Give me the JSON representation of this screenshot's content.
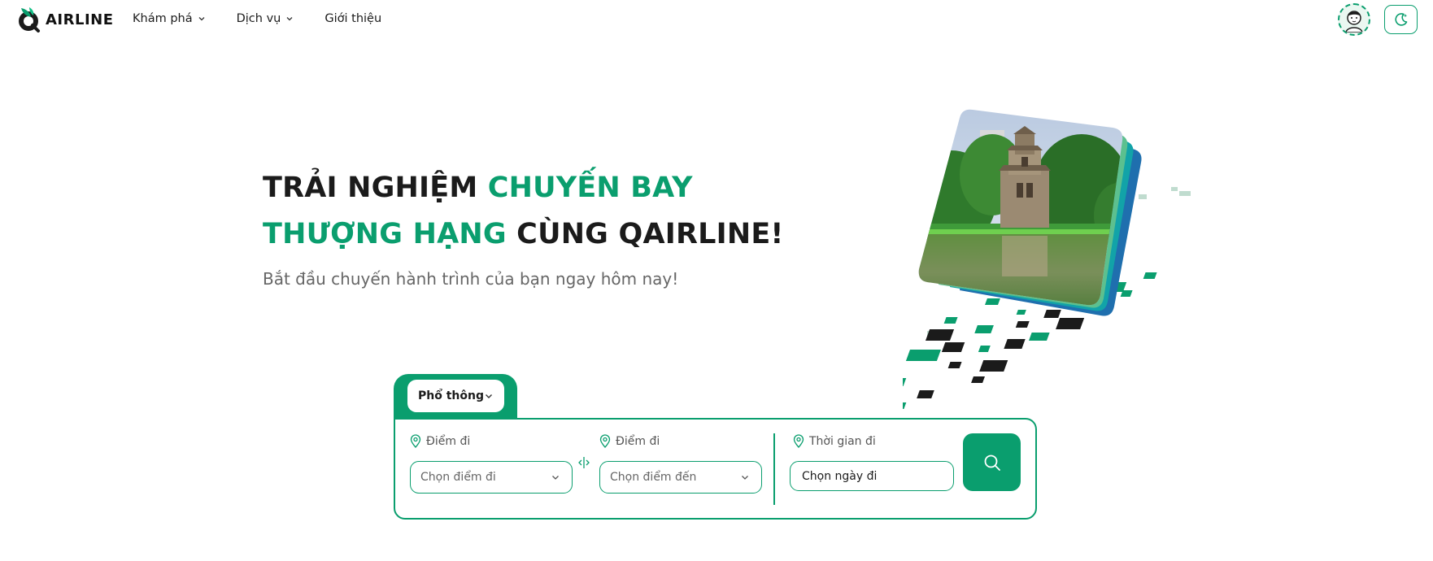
{
  "brand": {
    "name": "AIRLINE",
    "logo_icon": "qairline-logo-icon"
  },
  "nav": {
    "items": [
      {
        "label": "Khám phá",
        "icon": "chevron-down-icon"
      },
      {
        "label": "Dịch vụ",
        "icon": "chevron-down-icon"
      },
      {
        "label": "Giới thiệu"
      }
    ]
  },
  "header_right": {
    "avatar_icon": "user-avatar",
    "theme_toggle_icon": "moon-stars-icon"
  },
  "hero": {
    "title_part1": "TRẢI NGHIỆM ",
    "title_part2": "CHUYẾN BAY",
    "title_part3": "THƯỢNG HẠNG",
    "title_part4": " CÙNG QAIRLINE!",
    "subtitle": "Bắt đầu chuyến hành trình của bạn ngay hôm nay!",
    "illustration": "hanoi-turtle-tower-photo-card",
    "play_icon": "play-icon"
  },
  "search": {
    "cabin_class": "Phổ thông",
    "origin_label": "Điểm đi",
    "origin_placeholder": "Chọn điểm đi",
    "destination_label": "Điểm đi",
    "destination_placeholder": "Chọn điểm đến",
    "date_label": "Thời gian đi",
    "date_placeholder": "Chọn ngày đi",
    "swap_icon": "swap-icon",
    "search_icon": "search-icon"
  },
  "colors": {
    "accent": "#0a9e6e",
    "text": "#1b1b1b",
    "muted": "#666666"
  }
}
